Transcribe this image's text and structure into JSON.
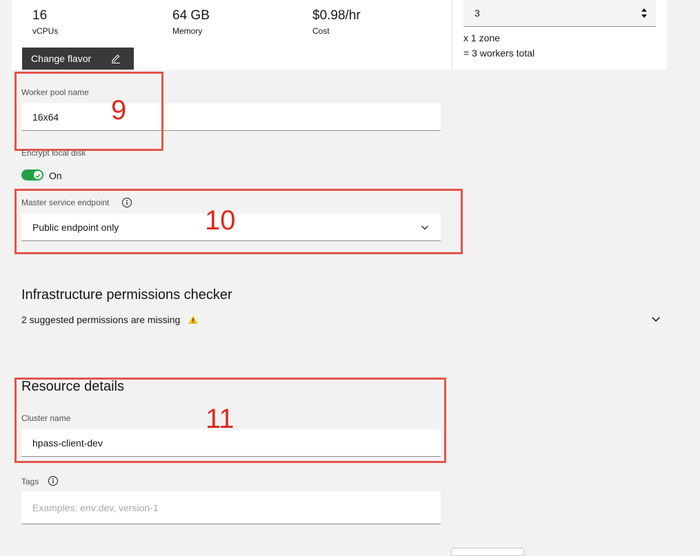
{
  "flavor": {
    "vcpu_value": "16",
    "vcpu_label": "vCPUs",
    "memory_value": "64 GB",
    "memory_label": "Memory",
    "cost_value": "$0.98/hr",
    "cost_label": "Cost",
    "change_button": "Change flavor"
  },
  "workers": {
    "per_zone_value": "3",
    "zone_text": "x 1 zone",
    "total_text": "= 3 workers total"
  },
  "worker_pool": {
    "label": "Worker pool name",
    "value": "16x64"
  },
  "encrypt": {
    "label": "Encrypt local disk",
    "state": "On"
  },
  "endpoint": {
    "label": "Master service endpoint",
    "value": "Public endpoint only"
  },
  "permissions": {
    "heading": "Infrastructure permissions checker",
    "status": "2 suggested permissions are missing"
  },
  "resource": {
    "heading": "Resource details",
    "cluster_label": "Cluster name",
    "cluster_value": "hpass-client-dev",
    "tags_label": "Tags",
    "tags_placeholder": "Examples: env:dev, version-1"
  },
  "annotations": [
    "9",
    "10",
    "11"
  ],
  "colors": {
    "annotation": "#e5544a",
    "toggle_on": "#24a148",
    "warning": "#f1c21b"
  }
}
